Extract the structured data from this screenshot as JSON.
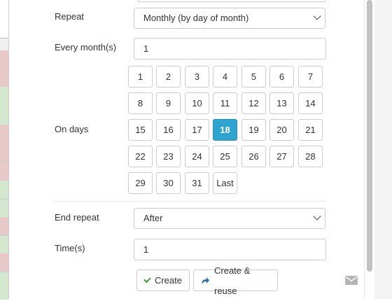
{
  "form": {
    "repeat_label": "Repeat",
    "repeat_value": "Monthly (by day of month)",
    "every_label": "Every month(s)",
    "every_value": "1",
    "on_days_label": "On days",
    "days": [
      "1",
      "2",
      "3",
      "4",
      "5",
      "6",
      "7",
      "8",
      "9",
      "10",
      "11",
      "12",
      "13",
      "14",
      "15",
      "16",
      "17",
      "18",
      "19",
      "20",
      "21",
      "22",
      "23",
      "24",
      "25",
      "26",
      "27",
      "28",
      "29",
      "30",
      "31",
      "Last"
    ],
    "selected_day": "18",
    "end_repeat_label": "End repeat",
    "end_repeat_value": "After",
    "times_label": "Time(s)",
    "times_value": "1"
  },
  "actions": {
    "create_label": "Create",
    "create_reuse_label": "Create & reuse"
  },
  "colors": {
    "accent": "#2fa4cf",
    "stripe_red": "#e8c9c9",
    "stripe_green": "#d3e8cf"
  },
  "icons": {
    "create": "check-icon",
    "create_reuse": "share-arrow-icon",
    "footer": "mail-icon"
  }
}
